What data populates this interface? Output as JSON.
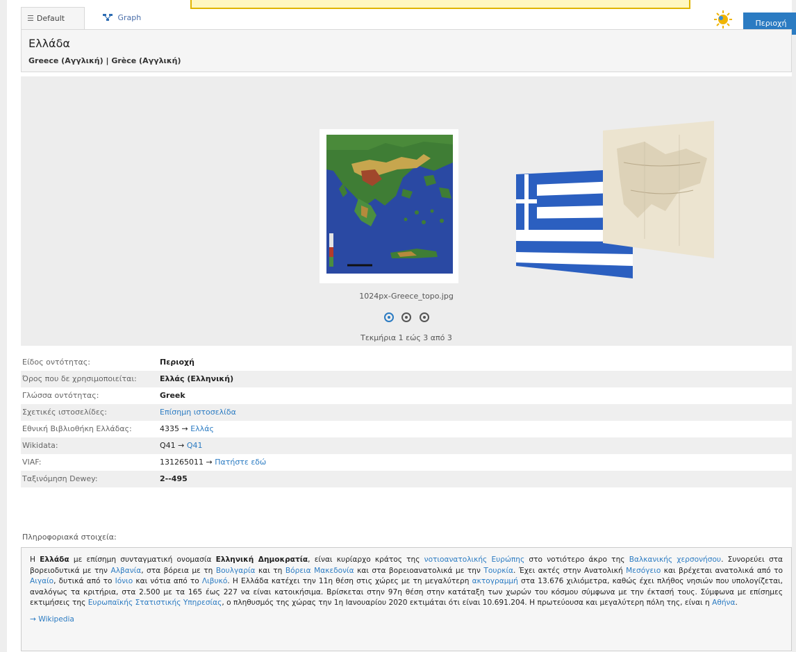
{
  "tabs": {
    "default_label": "Default",
    "graph_label": "Graph"
  },
  "header_button": {
    "label": "Περιοχή"
  },
  "entity": {
    "title": "Ελλάδα",
    "alt_name_1": "Greece (Αγγλική)",
    "separator": " | ",
    "alt_name_2": "Grèce (Αγγλική)"
  },
  "gallery": {
    "caption": "1024px-Greece_topo.jpg",
    "counter": "Τεκμήρια 1 εώς 3 από 3",
    "selected_index": 0,
    "dots": 3
  },
  "info_rows": [
    {
      "label": "Είδος οντότητας:",
      "value": "Περιοχή"
    },
    {
      "label": "Όρος που δε χρησιμοποιείται:",
      "value": "Ελλάς (Ελληνική)"
    },
    {
      "label": "Γλώσσα οντότητας:",
      "value": "Greek"
    },
    {
      "label": "Σχετικές ιστοσελίδες:",
      "link": "Επίσημη ιστοσελίδα"
    },
    {
      "label": "Εθνική Βιβλιοθήκη Ελλάδας:",
      "value": "4335 → ",
      "link": "Ελλάς"
    },
    {
      "label": "Wikidata:",
      "value": "Q41 → ",
      "link": "Q41"
    },
    {
      "label": "VIAF:",
      "value": "131265011 → ",
      "link": "Πατήστε εδώ"
    },
    {
      "label": "Ταξινόμηση Dewey:",
      "value": "2--495"
    }
  ],
  "info_section_label": "Πληροφοριακά στοιχεία:",
  "description": {
    "p1": "Η ",
    "b1": "Ελλάδα",
    "p2": " με επίσημη συνταγματική ονομασία ",
    "b2": "Ελληνική Δημοκρατία",
    "p3": ", είναι κυρίαρχο κράτος της ",
    "l1": "νοτιοανατολικής Ευρώπης",
    "p4": " στο νοτιότερο άκρο της ",
    "l2": "Βαλκανικής χερσονήσου",
    "p5": ". Συνορεύει στα βορειοδυτικά με την ",
    "l3": "Αλβανία",
    "p6": ", στα βόρεια με τη ",
    "l4": "Βουλγαρία",
    "p7": " και τη ",
    "l5": "Βόρεια Μακεδονία",
    "p8": " και στα βορειοανατολικά με την ",
    "l6": "Τουρκία",
    "p9": ". Έχει ακτές στην Ανατολική ",
    "l7": "Μεσόγειο",
    "p10": " και βρέχεται ανατολικά από το ",
    "l8": "Αιγαίο",
    "p11": ", δυτικά από το ",
    "l9": "Ιόνιο",
    "p12": " και νότια από το ",
    "l10": "Λιβυκό",
    "p13": ". Η Ελλάδα κατέχει την 11η θέση στις χώρες με τη μεγαλύτερη ",
    "l11": "ακτογραμμή",
    "p14": " στα 13.676 χιλιόμετρα, καθώς έχει πλήθος νησιών που υπολογίζεται, αναλόγως τα κριτήρια, στα 2.500 με τα 165 έως 227 να είναι κατοικήσιμα. Βρίσκεται στην 97η θέση στην κατάταξη των χωρών του κόσμου σύμφωνα με την έκτασή τους. Σύμφωνα με επίσημες εκτιμήσεις της ",
    "l12": "Ευρωπαϊκής Στατιστικής Υπηρεσίας",
    "p15": ", ο πληθυσμός της χώρας την 1η Ιανουαρίου 2020 εκτιμάται ότι είναι 10.691.204. Η πρωτεύουσα και μεγαλύτερη πόλη της, είναι η ",
    "l13": "Αθήνα",
    "p16": ".",
    "wiki_link": "→ Wikipedia"
  },
  "colors": {
    "accent": "#2b7bc2",
    "banner_bg": "#fff7bf",
    "banner_border": "#e0b400",
    "gallery_bg": "#ededed"
  },
  "icons": {
    "default_tab": "list-icon",
    "graph_tab": "graph-icon",
    "sun": "sun-icon"
  }
}
